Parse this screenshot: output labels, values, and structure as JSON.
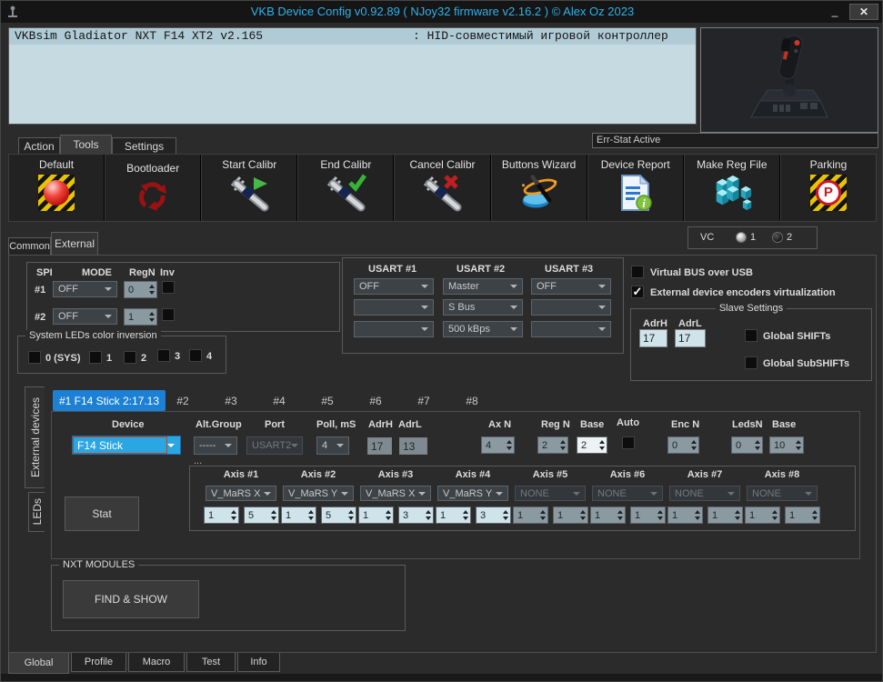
{
  "window": {
    "title": "VKB Device Config v0.92.89 ( NJoy32 firmware v2.16.2 ) © Alex Oz 2023",
    "minimize": "_",
    "close": "✕"
  },
  "device_info": {
    "name": "VKBsim Gladiator NXT F14  XT2 v2.165",
    "description": ": HID-совместимый игровой контроллер"
  },
  "err_stat": {
    "label": "Err-Stat Active"
  },
  "main_tabs": {
    "action": "Action",
    "tools": "Tools",
    "settings": "Settings"
  },
  "toolbar": {
    "buttons": [
      {
        "label": "Default",
        "icon": "hazard-ball-icon"
      },
      {
        "label": "Bootloader",
        "icon": "recycle-icon"
      },
      {
        "label": "Start Calibr",
        "icon": "caliper-play-icon"
      },
      {
        "label": "End Calibr",
        "icon": "caliper-check-icon"
      },
      {
        "label": "Cancel Calibr",
        "icon": "caliper-cross-icon"
      },
      {
        "label": "Buttons Wizard",
        "icon": "wizard-icon"
      },
      {
        "label": "Device Report",
        "icon": "report-icon"
      },
      {
        "label": "Make Reg File",
        "icon": "registry-cubes-icon"
      },
      {
        "label": "Parking",
        "icon": "parking-icon"
      }
    ]
  },
  "page_tabs": {
    "common": "Common",
    "external": "External"
  },
  "vc": {
    "label": "VC",
    "option1": "1",
    "option2": "2"
  },
  "spi": {
    "label": "SPI",
    "col_mode": "MODE",
    "col_regn": "RegN",
    "col_inv": "Inv",
    "rows": [
      {
        "id": "#1",
        "mode": "OFF",
        "regn": "0",
        "inv_checked": false
      },
      {
        "id": "#2",
        "mode": "OFF",
        "regn": "1",
        "inv_checked": false
      }
    ]
  },
  "sys_leds": {
    "title": "System LEDs color inversion",
    "options": [
      {
        "label": "0 (SYS)"
      },
      {
        "label": "1"
      },
      {
        "label": "2"
      },
      {
        "label": "3"
      },
      {
        "label": "4"
      }
    ]
  },
  "usart": {
    "groups": [
      {
        "title": "USART #1",
        "row1": "OFF",
        "row2": "",
        "row3": ""
      },
      {
        "title": "USART #2",
        "row1": "Master",
        "row2": "S Bus",
        "row3": "500 kBps"
      },
      {
        "title": "USART #3",
        "row1": "OFF",
        "row2": "",
        "row3": ""
      }
    ]
  },
  "bus_options": {
    "virtual_bus": "Virtual BUS over USB",
    "virtual_bus_checked": false,
    "encoders": "External device encoders virtualization",
    "encoders_checked": true
  },
  "slave": {
    "title": "Slave Settings",
    "adrh_label": "AdrH",
    "adrl_label": "AdrL",
    "adrh_value": "17",
    "adrl_value": "17",
    "shifts": "Global SHIFTs",
    "subshifts": "Global SubSHIFTs"
  },
  "side_tabs": {
    "external_devices": "External devices",
    "leds": "LEDs"
  },
  "device_tabs": {
    "t1": "#1 F14 Stick 2:17.13",
    "t2": "#2",
    "t3": "#3",
    "t4": "#4",
    "t5": "#5",
    "t6": "#6",
    "t7": "#7",
    "t8": "#8"
  },
  "device": {
    "device_label": "Device",
    "device_value": "F14 Stick",
    "alt_group_label": "Alt.Group",
    "alt_group_value": "-----",
    "port_label": "Port",
    "port_value": "USART2",
    "poll_label": "Poll, mS",
    "poll_value": "4",
    "adrh_label": "AdrH",
    "adrh_value": "17",
    "adrl_label": "AdrL",
    "adrl_value": "13",
    "axn_label": "Ax N",
    "axn_value": "4",
    "regn_label": "Reg N",
    "regn_value": "2",
    "base_label": "Base",
    "base_value": "2",
    "auto_label": "Auto",
    "auto_checked": false,
    "encn_label": "Enc N",
    "encn_value": "0",
    "ledsn_label": "LedsN",
    "ledsn_value": "0",
    "base2_label": "Base",
    "base2_value": "10",
    "more": "...",
    "stat_button": "Stat"
  },
  "axes": {
    "items": [
      {
        "title": "Axis #1",
        "source": "V_MaRS X",
        "v1": "1",
        "v2": "5"
      },
      {
        "title": "Axis #2",
        "source": "V_MaRS Y",
        "v1": "1",
        "v2": "5"
      },
      {
        "title": "Axis #3",
        "source": "V_MaRS X",
        "v1": "1",
        "v2": "3"
      },
      {
        "title": "Axis #4",
        "source": "V_MaRS Y",
        "v1": "1",
        "v2": "3"
      },
      {
        "title": "Axis #5",
        "source": "NONE",
        "v1": "1",
        "v2": "1"
      },
      {
        "title": "Axis #6",
        "source": "NONE",
        "v1": "1",
        "v2": "1"
      },
      {
        "title": "Axis #7",
        "source": "NONE",
        "v1": "1",
        "v2": "1"
      },
      {
        "title": "Axis #8",
        "source": "NONE",
        "v1": "1",
        "v2": "1"
      }
    ]
  },
  "nxt": {
    "title": "NXT MODULES",
    "button": "FIND &  SHOW"
  },
  "bottom_tabs": {
    "global": "Global",
    "profile": "Profile",
    "macro": "Macro",
    "test": "Test",
    "info": "Info"
  },
  "colors": {
    "accent_blue": "#1c80d4",
    "title_text": "#2eb2ea",
    "info_panel": "#c6dae2",
    "field_blue": "#cfe3ea",
    "selected_dropdown": "#2aa7e2"
  }
}
